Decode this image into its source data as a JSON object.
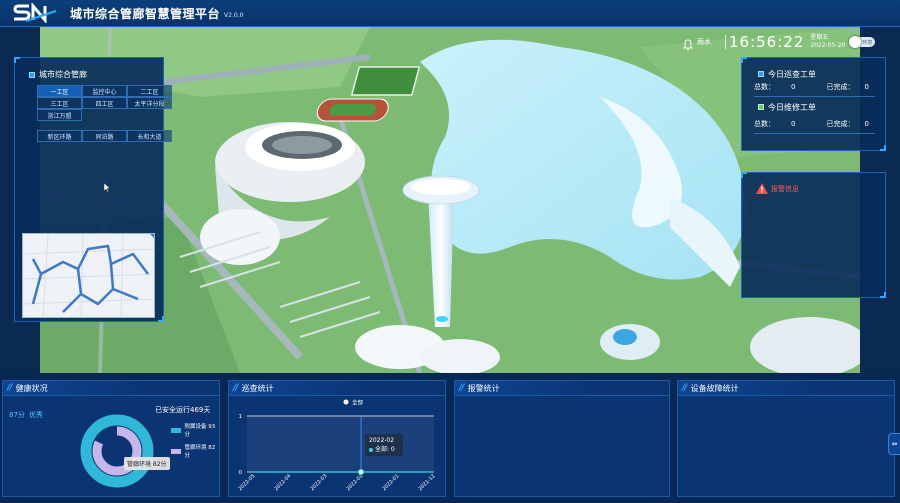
{
  "header": {
    "logo_text": "SN",
    "title": "城市综合管廊智慧管理平台",
    "version": "V2.0.0"
  },
  "status": {
    "weather": "雨水",
    "clock": "16:56:22",
    "weekday": "星期五",
    "date": "2022-05-20",
    "toggle_label": "环境"
  },
  "left_panel": {
    "title": "城市综合管廊",
    "districts": [
      "一工区",
      "监控中心",
      "二工区",
      "三工区",
      "四工区",
      "太平洋分段",
      "浙江万盟"
    ],
    "roads": [
      "新区环路",
      "同泊路",
      "长和大道"
    ],
    "active_index": 0
  },
  "work_orders": {
    "inspection": {
      "title": "今日巡查工单",
      "total_label": "总数：",
      "total": "0",
      "done_label": "已完成：",
      "done": "0"
    },
    "repair": {
      "title": "今日维修工单",
      "total_label": "总数：",
      "total": "0",
      "done_label": "已完成：",
      "done": "0"
    }
  },
  "alarm_panel": {
    "title": "报警信息"
  },
  "bottom": {
    "health": {
      "title": "健康状况",
      "score": "87分",
      "grade": "优秀",
      "safe_days": "已安全运行469天",
      "legend": [
        {
          "label": "附属设备 93分",
          "color": "#2fb8d8"
        },
        {
          "label": "管廊环境 82分",
          "color": "#c6b7ea"
        }
      ],
      "tooltip": "管廊环境 82分"
    },
    "inspection": {
      "title": "巡查统计",
      "legend_label": "全部",
      "tooltip_date": "2022-02",
      "tooltip_value": "全部: 0"
    },
    "alarm": {
      "title": "报警统计"
    },
    "device": {
      "title": "设备故障统计"
    }
  },
  "chart_data": {
    "type": "line",
    "x": [
      "2022-05",
      "2022-04",
      "2022-03",
      "2022-02",
      "2022-01",
      "2021-12"
    ],
    "series": [
      {
        "name": "全部",
        "values": [
          0,
          0,
          0,
          0,
          0,
          0
        ]
      }
    ],
    "ylim": [
      0,
      1
    ],
    "yticks": [
      "0",
      "1"
    ],
    "legend": "top-center",
    "grid": true
  },
  "colors": {
    "accent": "#36a4ff",
    "panel_bg": "#092c5a",
    "health_cyan": "#2fb8d8",
    "health_purple": "#c6b7ea",
    "alarm_red": "#ff5b5b",
    "line": "#36d7e6"
  },
  "icons": {
    "bell": "bell-icon",
    "alarm": "warning-icon",
    "slash": "double-slash-icon"
  }
}
